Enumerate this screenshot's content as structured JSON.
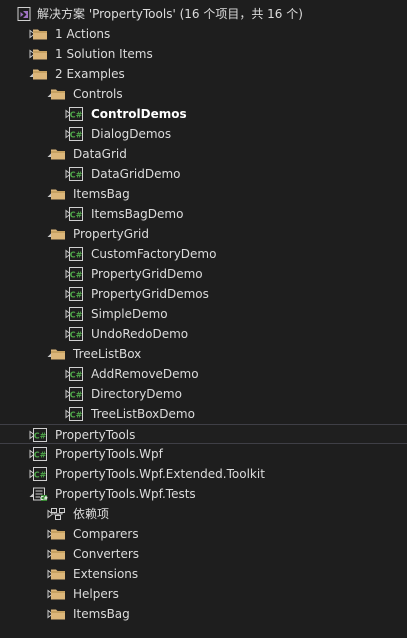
{
  "explorer": {
    "items": [
      {
        "label": "解决方案 'PropertyTools' (16 个项目，共 16 个)",
        "level": 0,
        "icon": "solution",
        "expander": "none"
      },
      {
        "label": "1 Actions",
        "level": 1,
        "icon": "folder",
        "expander": "collapsed"
      },
      {
        "label": "1 Solution Items",
        "level": 1,
        "icon": "folder",
        "expander": "collapsed"
      },
      {
        "label": "2 Examples",
        "level": 1,
        "icon": "folder",
        "expander": "expanded"
      },
      {
        "label": "Controls",
        "level": 2,
        "icon": "folder",
        "expander": "expanded"
      },
      {
        "label": "ControlDemos",
        "level": 3,
        "icon": "csproj",
        "expander": "collapsed",
        "bold": true
      },
      {
        "label": "DialogDemos",
        "level": 3,
        "icon": "csproj",
        "expander": "collapsed"
      },
      {
        "label": "DataGrid",
        "level": 2,
        "icon": "folder",
        "expander": "expanded"
      },
      {
        "label": "DataGridDemo",
        "level": 3,
        "icon": "csproj",
        "expander": "collapsed"
      },
      {
        "label": "ItemsBag",
        "level": 2,
        "icon": "folder",
        "expander": "expanded"
      },
      {
        "label": "ItemsBagDemo",
        "level": 3,
        "icon": "csproj",
        "expander": "collapsed"
      },
      {
        "label": "PropertyGrid",
        "level": 2,
        "icon": "folder",
        "expander": "expanded"
      },
      {
        "label": "CustomFactoryDemo",
        "level": 3,
        "icon": "csproj",
        "expander": "collapsed"
      },
      {
        "label": "PropertyGridDemo",
        "level": 3,
        "icon": "csproj",
        "expander": "collapsed"
      },
      {
        "label": "PropertyGridDemos",
        "level": 3,
        "icon": "csproj",
        "expander": "collapsed"
      },
      {
        "label": "SimpleDemo",
        "level": 3,
        "icon": "csproj",
        "expander": "collapsed"
      },
      {
        "label": "UndoRedoDemo",
        "level": 3,
        "icon": "csproj",
        "expander": "collapsed"
      },
      {
        "label": "TreeListBox",
        "level": 2,
        "icon": "folder",
        "expander": "expanded"
      },
      {
        "label": "AddRemoveDemo",
        "level": 3,
        "icon": "csproj",
        "expander": "collapsed"
      },
      {
        "label": "DirectoryDemo",
        "level": 3,
        "icon": "csproj",
        "expander": "collapsed"
      },
      {
        "label": "TreeListBoxDemo",
        "level": 3,
        "icon": "csproj",
        "expander": "collapsed"
      },
      {
        "label": "PropertyTools",
        "level": 1,
        "icon": "csproj",
        "expander": "collapsed",
        "selected": true
      },
      {
        "label": "PropertyTools.Wpf",
        "level": 1,
        "icon": "csproj",
        "expander": "collapsed"
      },
      {
        "label": "PropertyTools.Wpf.Extended.Toolkit",
        "level": 1,
        "icon": "csproj",
        "expander": "collapsed"
      },
      {
        "label": "PropertyTools.Wpf.Tests",
        "level": 1,
        "icon": "testproj",
        "expander": "expanded"
      },
      {
        "label": "依赖项",
        "level": 2,
        "icon": "dependencies",
        "expander": "collapsed"
      },
      {
        "label": "Comparers",
        "level": 2,
        "icon": "folder",
        "expander": "collapsed"
      },
      {
        "label": "Converters",
        "level": 2,
        "icon": "folder",
        "expander": "collapsed"
      },
      {
        "label": "Extensions",
        "level": 2,
        "icon": "folder",
        "expander": "collapsed"
      },
      {
        "label": "Helpers",
        "level": 2,
        "icon": "folder",
        "expander": "collapsed"
      },
      {
        "label": "ItemsBag",
        "level": 2,
        "icon": "folder",
        "expander": "collapsed"
      }
    ]
  },
  "colors": {
    "background": "#1e1e1e",
    "text": "#dcdcdc",
    "folder": "#dcb67a",
    "csharp_green": "#388a34",
    "solution_purple": "#a074c4",
    "chevron": "#c8c8c8"
  }
}
